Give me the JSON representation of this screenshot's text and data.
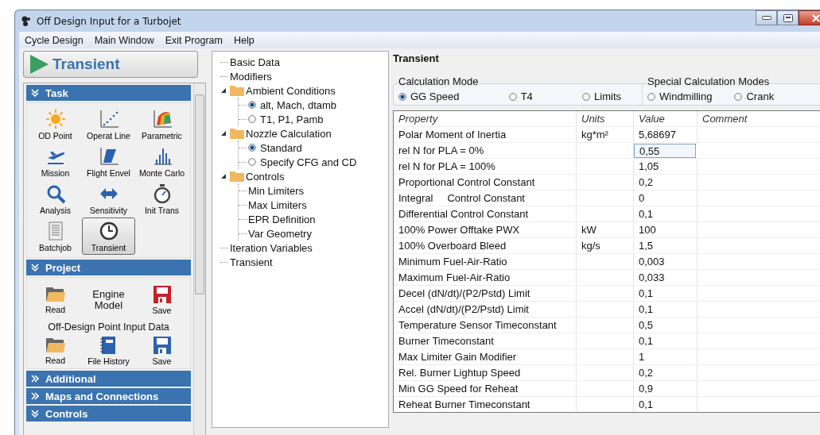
{
  "window": {
    "title": "Off Design Input for a Turbojet"
  },
  "menu": [
    "Cycle Design",
    "Main Window",
    "Exit Program",
    "Help"
  ],
  "run_button": {
    "label": "Transient"
  },
  "sections": [
    {
      "title": "Task",
      "expanded": true,
      "kind": "tasks",
      "items": [
        {
          "label": "OD Point",
          "selected": false
        },
        {
          "label": "Operat Line",
          "selected": false
        },
        {
          "label": "Parametric",
          "selected": false
        },
        {
          "label": "Mission",
          "selected": false
        },
        {
          "label": "Flight Envel",
          "selected": false
        },
        {
          "label": "Monte Carlo",
          "selected": false
        },
        {
          "label": "Analysis",
          "selected": false
        },
        {
          "label": "Sensitivity",
          "selected": false
        },
        {
          "label": "Init Trans",
          "selected": false
        },
        {
          "label": "Batchjob",
          "selected": false
        },
        {
          "label": "Transient",
          "selected": true
        }
      ]
    },
    {
      "title": "Project",
      "expanded": true,
      "kind": "project",
      "engine_model": {
        "title": "Engine Model",
        "read": "Read",
        "save": "Save"
      },
      "od_data": {
        "title": "Off-Design Point Input Data",
        "items": [
          "Read",
          "File History",
          "Save"
        ]
      }
    },
    {
      "title": "Additional",
      "expanded": false,
      "kind": "collapsed"
    },
    {
      "title": "Maps and Connections",
      "expanded": false,
      "kind": "collapsed"
    },
    {
      "title": "Controls",
      "expanded": true,
      "kind": "collapsed"
    }
  ],
  "tree": [
    {
      "label": "Basic Data",
      "kind": "leaf"
    },
    {
      "label": "Modifiers",
      "kind": "leaf"
    },
    {
      "label": "Ambient Conditions",
      "kind": "folder",
      "expanded": true,
      "children": [
        {
          "label": "alt, Mach, dtamb",
          "kind": "radio",
          "selected": true
        },
        {
          "label": "T1, P1, Pamb",
          "kind": "radio",
          "selected": false
        }
      ]
    },
    {
      "label": "Nozzle Calculation",
      "kind": "folder",
      "expanded": true,
      "children": [
        {
          "label": "Standard",
          "kind": "radio",
          "selected": true
        },
        {
          "label": "Specify CFG and CD",
          "kind": "radio",
          "selected": false
        }
      ]
    },
    {
      "label": "Controls",
      "kind": "folder",
      "expanded": true,
      "children": [
        {
          "label": "Min Limiters",
          "kind": "leaf"
        },
        {
          "label": "Max Limiters",
          "kind": "leaf"
        },
        {
          "label": "EPR Definition",
          "kind": "leaf"
        },
        {
          "label": "Var Geometry",
          "kind": "leaf"
        }
      ]
    },
    {
      "label": "Iteration Variables",
      "kind": "leaf"
    },
    {
      "label": "Transient",
      "kind": "leaf"
    }
  ],
  "panel_title": "Transient",
  "calculation_mode": {
    "title": "Calculation Mode",
    "options": [
      {
        "label": "GG Speed",
        "selected": true
      },
      {
        "label": "T4",
        "selected": false
      },
      {
        "label": "Limits",
        "selected": false
      }
    ]
  },
  "special_modes": {
    "title": "Special Calculation Modes",
    "options": [
      {
        "label": "Windmilling",
        "selected": false
      },
      {
        "label": "Crank",
        "selected": false
      }
    ]
  },
  "table": {
    "columns": [
      "Property",
      "Units",
      "Value",
      "Comment"
    ],
    "rows": [
      {
        "property": "Polar Moment of Inertia",
        "units": "kg*m²",
        "value": "5,68697",
        "selected": false
      },
      {
        "property": "rel N for PLA = 0%",
        "value": "0,55",
        "selected": true
      },
      {
        "property": "rel N for PLA = 100%",
        "value": "1,05",
        "selected": false
      },
      {
        "property": "Proportional Control Constant",
        "value": "0,2",
        "selected": false
      },
      {
        "property": "Integral     Control Constant",
        "value": "0",
        "selected": false
      },
      {
        "property": "Differential Control Constant",
        "value": "0,1",
        "selected": false
      },
      {
        "property": "100% Power Offtake PWX",
        "units": "kW",
        "value": "100",
        "selected": false
      },
      {
        "property": "100% Overboard Bleed",
        "units": "kg/s",
        "value": "1,5",
        "selected": false
      },
      {
        "property": "Minimum Fuel-Air-Ratio",
        "value": "0,003",
        "selected": false
      },
      {
        "property": "Maximum Fuel-Air-Ratio",
        "value": "0,033",
        "selected": false
      },
      {
        "property": "Decel (dN/dt)/(P2/Pstd) Limit",
        "value": "0,1",
        "selected": false
      },
      {
        "property": "Accel (dN/dt)/(P2/Pstd) Limit",
        "value": "0,1",
        "selected": false
      },
      {
        "property": "Temperature Sensor Timeconstant",
        "value": "0,5",
        "selected": false
      },
      {
        "property": "Burner Timeconstant",
        "value": "0,1",
        "selected": false
      },
      {
        "property": "Max Limiter Gain Modifier",
        "value": "1",
        "selected": false
      },
      {
        "property": "Rel. Burner Lightup Speed",
        "value": "0,2",
        "selected": false
      },
      {
        "property": "Min GG Speed for Reheat",
        "value": "0,9",
        "selected": false
      },
      {
        "property": "Reheat Burner Timeconstant",
        "value": "0,1",
        "selected": false
      }
    ]
  }
}
